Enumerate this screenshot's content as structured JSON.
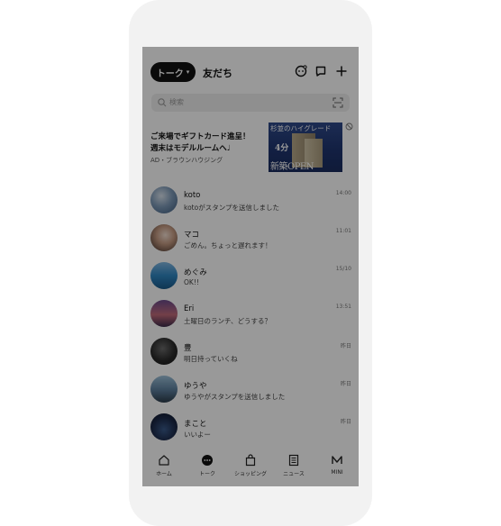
{
  "header": {
    "talk_label": "トーク",
    "friends_label": "友だち"
  },
  "search": {
    "placeholder": "検索"
  },
  "ad": {
    "line1": "ご来場でギフトカード進呈！",
    "line2": "週末はモデルルームへ♩",
    "sponsor": "AD・ブラウンハウジング",
    "image_text_top": "杉並のハイグレード",
    "image_text_badge": "4分",
    "image_text_big": "新築OPEN"
  },
  "chats": [
    {
      "name": "koto",
      "message": "kotoがスタンプを送信しました",
      "time": "14:00",
      "avatar": "#5b7fa8"
    },
    {
      "name": "マコ",
      "message": "ごめん。ちょっと遅れます！",
      "time": "11:01",
      "avatar": "#b89a8a"
    },
    {
      "name": "めぐみ",
      "message": "OK!!",
      "time": "15/10",
      "avatar": "#3a86b8"
    },
    {
      "name": "Eri",
      "message": "土曜日のランチ、どうする？",
      "time": "13:51",
      "avatar": "#8a6aa0"
    },
    {
      "name": "豊",
      "message": "明日持っていくね",
      "time": "昨日",
      "avatar": "#2a2a2a"
    },
    {
      "name": "ゆうや",
      "message": "ゆうやがスタンプを送信しました",
      "time": "昨日",
      "avatar": "#5a7c9a"
    },
    {
      "name": "まこと",
      "message": "いいよー",
      "time": "昨日",
      "avatar": "#1c2a4a"
    }
  ],
  "tabs": [
    {
      "label": "ホーム",
      "icon": "home-icon"
    },
    {
      "label": "トーク",
      "icon": "talk-icon"
    },
    {
      "label": "ショッピング",
      "icon": "shopping-icon"
    },
    {
      "label": "ニュース",
      "icon": "news-icon"
    },
    {
      "label": "MINI",
      "icon": "mini-icon"
    }
  ]
}
